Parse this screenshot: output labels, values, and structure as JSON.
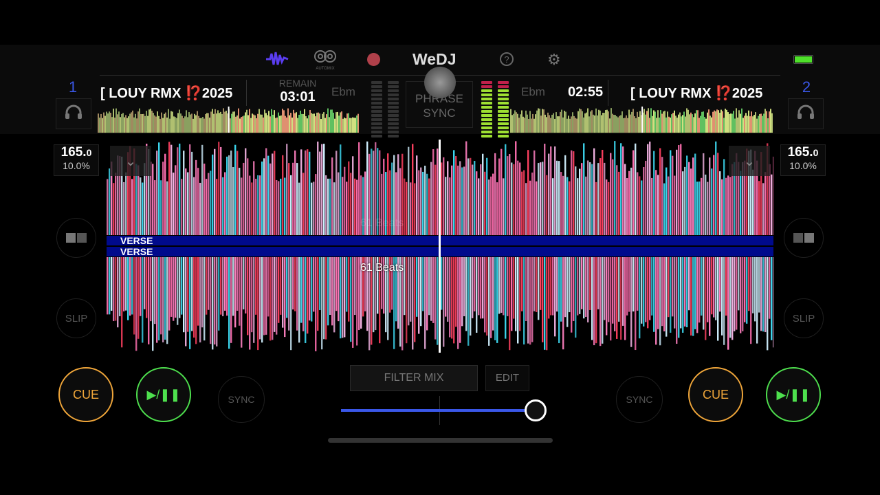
{
  "app": {
    "name": "WeDJ"
  },
  "toolbar": {
    "icons": [
      "waveform-icon",
      "automix-icon",
      "record-icon",
      "help-icon",
      "settings-icon",
      "battery-icon"
    ],
    "automix_label": "AUTOMIX",
    "accent": "#5a3df0",
    "record_color": "#b0404a",
    "battery_color": "#4ee02a"
  },
  "center": {
    "phrase_sync": "PHRASE SYNC",
    "beats_label": "61 Beats",
    "beats_label_faded": "61 Beats"
  },
  "deck1": {
    "number": "1",
    "title_prefix": "[ LOUY RMX ",
    "title_emoji": "⁉️",
    "title_suffix": "2025",
    "remain_label": "REMAIN",
    "time": "03:01",
    "key": "Ebm",
    "bpm": "165.",
    "bpm_decimal": "0",
    "pitch": "10.0%",
    "phrase": "VERSE",
    "slip": "SLIP",
    "cue": "CUE",
    "play": "▶/❚❚",
    "sync": "SYNC"
  },
  "deck2": {
    "number": "2",
    "title_prefix": "[ LOUY RMX ",
    "title_emoji": "⁉️",
    "title_suffix": "2025",
    "time": "02:55",
    "key": "Ebm",
    "bpm": "165.",
    "bpm_decimal": "0",
    "pitch": "10.0%",
    "phrase": "VERSE",
    "slip": "SLIP",
    "cue": "CUE",
    "play": "▶/❚❚",
    "sync": "SYNC"
  },
  "mixer": {
    "filter_mix": "FILTER MIX",
    "edit": "EDIT",
    "crossfader_position": 1.0
  },
  "colors": {
    "deck_number": "#3a57e8",
    "cue": "#f0a63a",
    "play": "#4ee04e",
    "phrase_bar": "#000a8c",
    "wave_pink": "#ff6fb0",
    "wave_cyan": "#3dd8f0"
  }
}
